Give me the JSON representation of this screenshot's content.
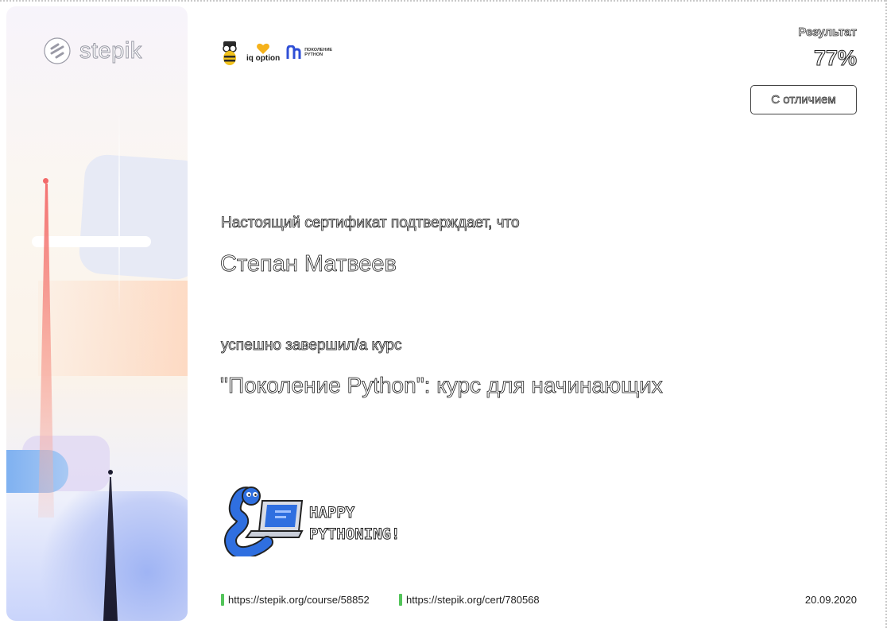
{
  "brand": {
    "logo_text": "stepik"
  },
  "partners": {
    "iq_option": "iq option",
    "np_line1": "ПОКОЛЕНИЕ",
    "np_line2": "PYTHON"
  },
  "result": {
    "label": "Результат",
    "value": "77%",
    "grade": "С отличием"
  },
  "certificate": {
    "intro": "Настоящий сертификат подтверждает, что",
    "recipient_name": "Степан Матвеев",
    "completed_text": "успешно завершил/а  курс",
    "course_title": "\"Поколение Python\": курс для начинающих"
  },
  "mascot": {
    "line1": "HAPPY",
    "line2": "PYTHONING!"
  },
  "footer": {
    "course_url": "https://stepik.org/course/58852",
    "cert_url": "https://stepik.org/cert/780568",
    "date": "20.09.2020"
  },
  "colors": {
    "accent_green": "#53c45a",
    "accent_red": "#f26a6a",
    "mascot_blue": "#2f6fe0"
  }
}
